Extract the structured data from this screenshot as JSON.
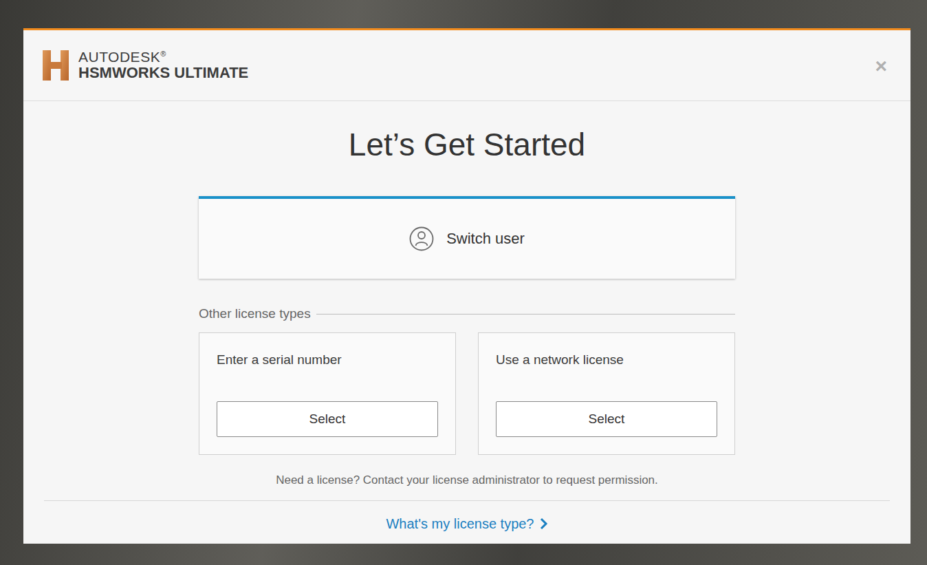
{
  "window": {
    "title": "Let’s Get Started"
  },
  "product": {
    "vendor": "AUTODESK",
    "trademark": "®",
    "name": "HSMWORKS ULTIMATE"
  },
  "close_button": "×",
  "primary_option": {
    "label": "Switch user"
  },
  "section_label": "Other license types",
  "license_options": [
    {
      "title": "Enter a serial number",
      "button": "Select"
    },
    {
      "title": "Use a network license",
      "button": "Select"
    }
  ],
  "note": "Need a license? Contact your license administrator to request permission.",
  "help_link": {
    "label": "What's my license type?"
  }
}
